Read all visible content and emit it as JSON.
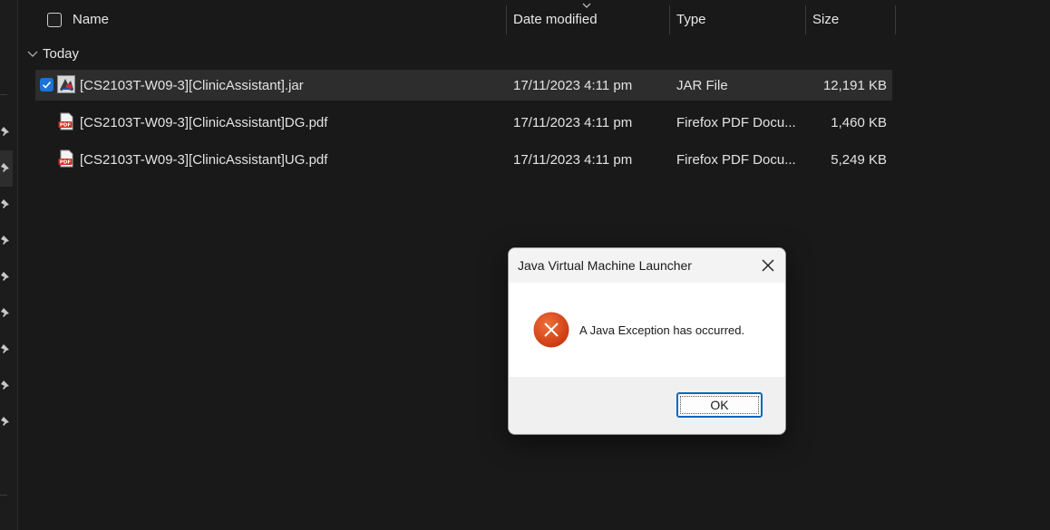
{
  "columns": {
    "name": "Name",
    "date_modified": "Date modified",
    "type": "Type",
    "size": "Size",
    "sorted_by": "Date modified"
  },
  "group": {
    "label": "Today",
    "expanded": true
  },
  "files": [
    {
      "name": "[CS2103T-W09-3][ClinicAssistant].jar",
      "date": "17/11/2023 4:11 pm",
      "type": "JAR File",
      "size": "12,191 KB",
      "selected": true,
      "icon": "jar-file-icon"
    },
    {
      "name": "[CS2103T-W09-3][ClinicAssistant]DG.pdf",
      "date": "17/11/2023 4:11 pm",
      "type": "Firefox PDF Docu...",
      "size": "1,460 KB",
      "selected": false,
      "icon": "pdf-file-icon"
    },
    {
      "name": "[CS2103T-W09-3][ClinicAssistant]UG.pdf",
      "date": "17/11/2023 4:11 pm",
      "type": "Firefox PDF Docu...",
      "size": "5,249 KB",
      "selected": false,
      "icon": "pdf-file-icon"
    }
  ],
  "dialog": {
    "title": "Java Virtual Machine Launcher",
    "message": "A Java Exception has occurred.",
    "ok_label": "OK",
    "icon": "error-icon"
  },
  "colors": {
    "background": "#191919",
    "selected_row": "#2d2d2d",
    "checkbox_accent": "#1a73d9",
    "error_red": "#e0461f",
    "button_border": "#0067c0"
  }
}
